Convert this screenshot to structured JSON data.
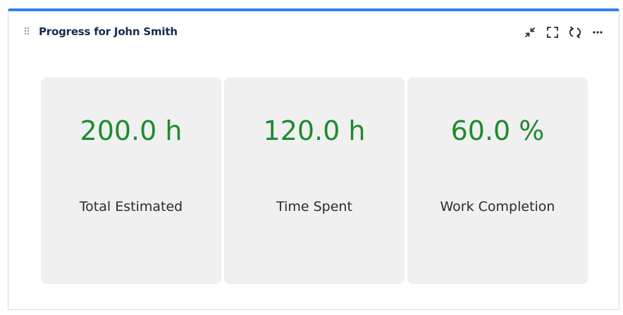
{
  "gadget": {
    "title": "Progress for John Smith",
    "accent_color": "#2f80ed",
    "actions": [
      {
        "icon": "minimize-icon"
      },
      {
        "icon": "fullscreen-icon"
      },
      {
        "icon": "refresh-icon"
      },
      {
        "icon": "more-options-icon"
      }
    ]
  },
  "metrics": [
    {
      "value": "200.0 h",
      "label": "Total Estimated"
    },
    {
      "value": "120.0 h",
      "label": "Time Spent"
    },
    {
      "value": "60.0 %",
      "label": "Work Completion"
    }
  ],
  "colors": {
    "value_text": "#1e8a2e",
    "card_background": "#f0f0f0"
  }
}
